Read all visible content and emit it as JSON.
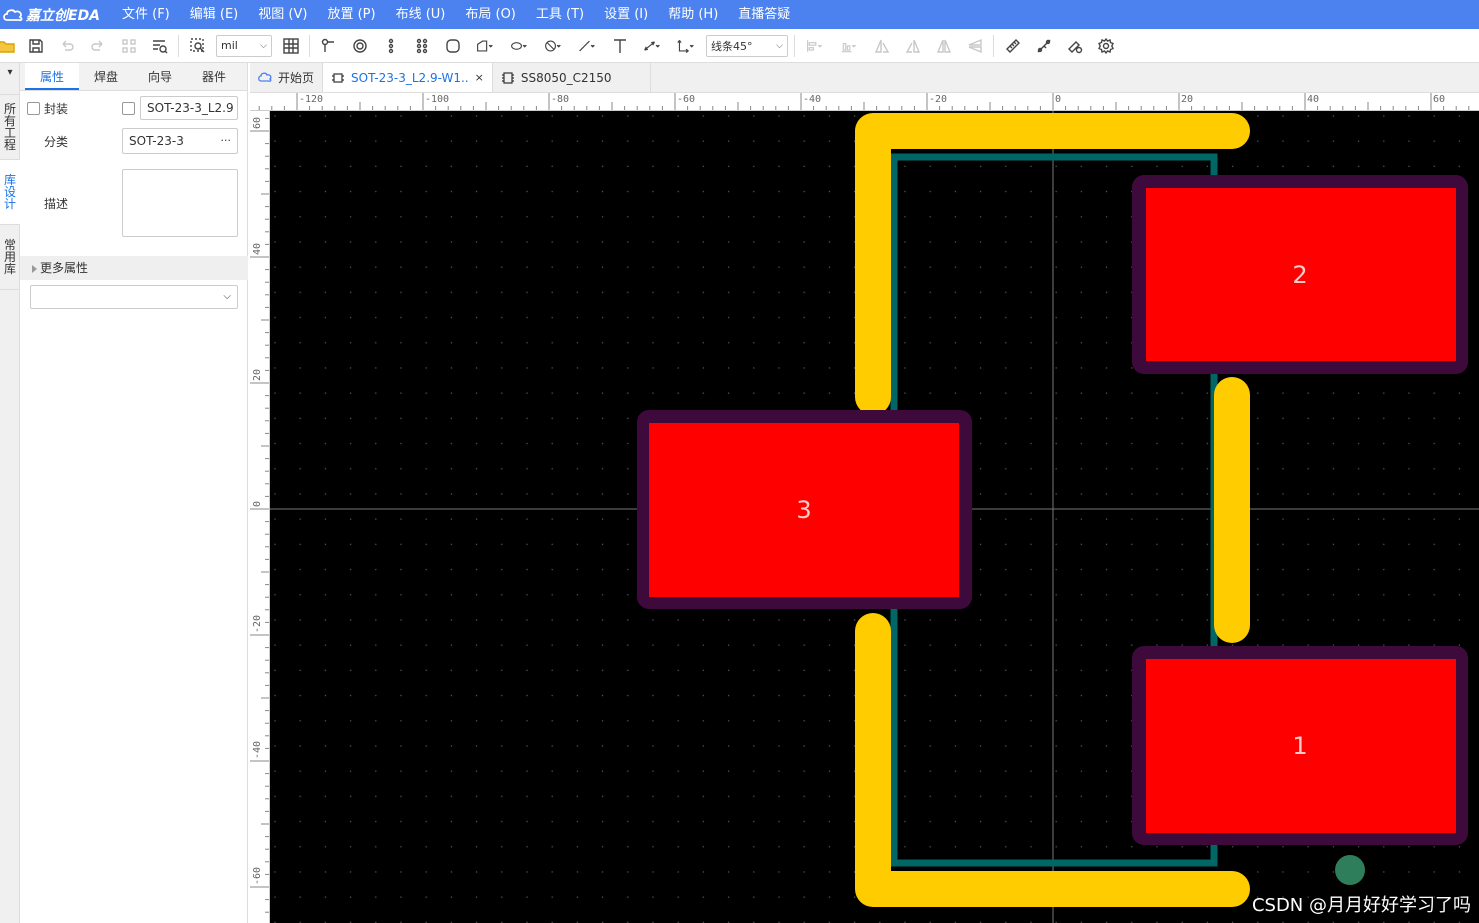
{
  "app": {
    "logo_text": "嘉立创EDA",
    "menu": [
      "文件 (F)",
      "编辑 (E)",
      "视图 (V)",
      "放置 (P)",
      "布线 (U)",
      "布局 (O)",
      "工具 (T)",
      "设置 (I)",
      "帮助 (H)",
      "直播答疑"
    ]
  },
  "toolbar": {
    "unit_select": "mil",
    "route_mode_select": "线条45°"
  },
  "left_tabs": [
    "所有工程",
    "库设计",
    "常用库"
  ],
  "panel": {
    "tabs": [
      "属性",
      "焊盘",
      "向导",
      "器件"
    ],
    "footprint_label": "封装",
    "footprint_value": "SOT-23-3_L2.9",
    "category_label": "分类",
    "category_value": "SOT-23-3",
    "category_more": "···",
    "desc_label": "描述",
    "more_props": "更多属性"
  },
  "doc_tabs": [
    {
      "label": "开始页",
      "icon": "cloud-icon"
    },
    {
      "label": "SOT-23-3_L2.9-W1..",
      "icon": "footprint-icon",
      "close": "×"
    },
    {
      "label": "SS8050_C2150",
      "icon": "chip-icon"
    }
  ],
  "ruler": {
    "top_labels": [
      "-120",
      "-100",
      "-80",
      "-60",
      "-40",
      "-20",
      "0",
      "20",
      "40",
      "60"
    ],
    "left_labels": [
      "60",
      "40",
      "20",
      "0",
      "-20",
      "-40",
      "-60"
    ]
  },
  "pads": [
    {
      "number": "1"
    },
    {
      "number": "2"
    },
    {
      "number": "3"
    }
  ],
  "colors": {
    "menubar": "#4b82f0",
    "pad": "#ff0000",
    "pad_mask": "#3d0a3b",
    "silkscreen": "#ffcc00",
    "outline": "#006666",
    "canvas": "#000000"
  },
  "watermark": "CSDN @月月好好学习了吗"
}
